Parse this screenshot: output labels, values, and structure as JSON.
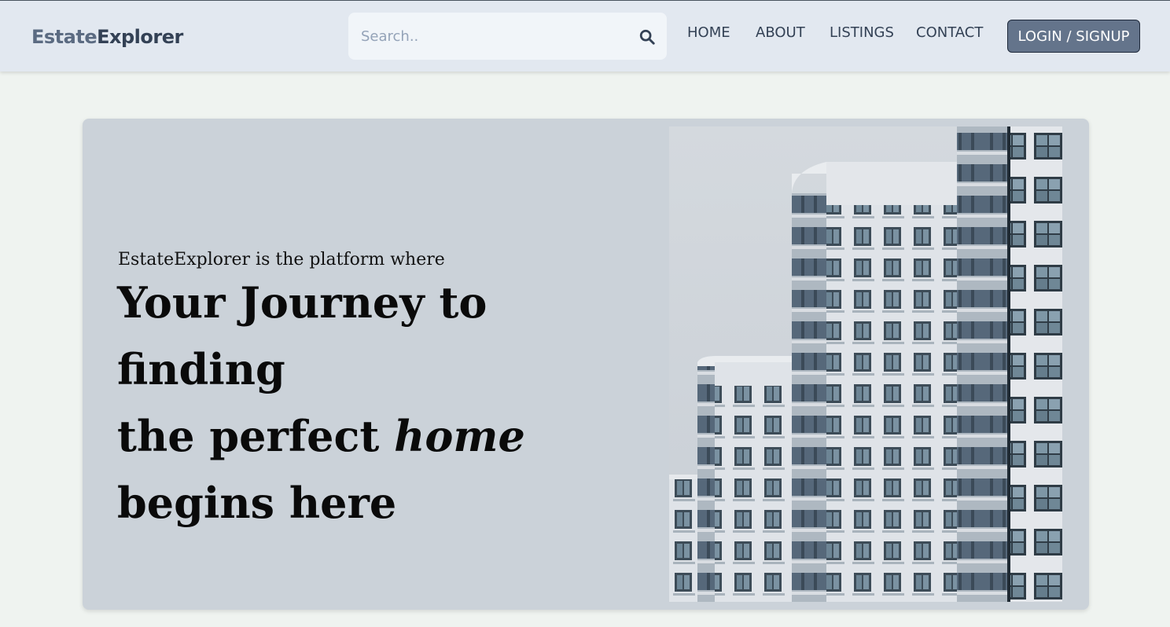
{
  "header": {
    "logo_part1": "Estate",
    "logo_part2": "Explorer",
    "search_placeholder": "Search..",
    "search_icon": "search-icon",
    "nav": [
      "HOME",
      "ABOUT",
      "LISTINGS",
      "CONTACT"
    ],
    "login_label": "LOGIN / SIGNUP"
  },
  "hero": {
    "tagline": "EstateExplorer is the platform where",
    "line1": "Your Journey to finding",
    "line2_prefix": "the perfect ",
    "line2_emphasis": "home",
    "line3": "begins here",
    "image": "apartment-buildings-photo"
  },
  "colors": {
    "header_bg": "#e2e8f0",
    "page_bg": "#eff3f0",
    "hero_bg": "#cbd2d9",
    "button_bg": "#64748b",
    "logo_accent": "#5b6b82",
    "logo_dark": "#334155"
  }
}
